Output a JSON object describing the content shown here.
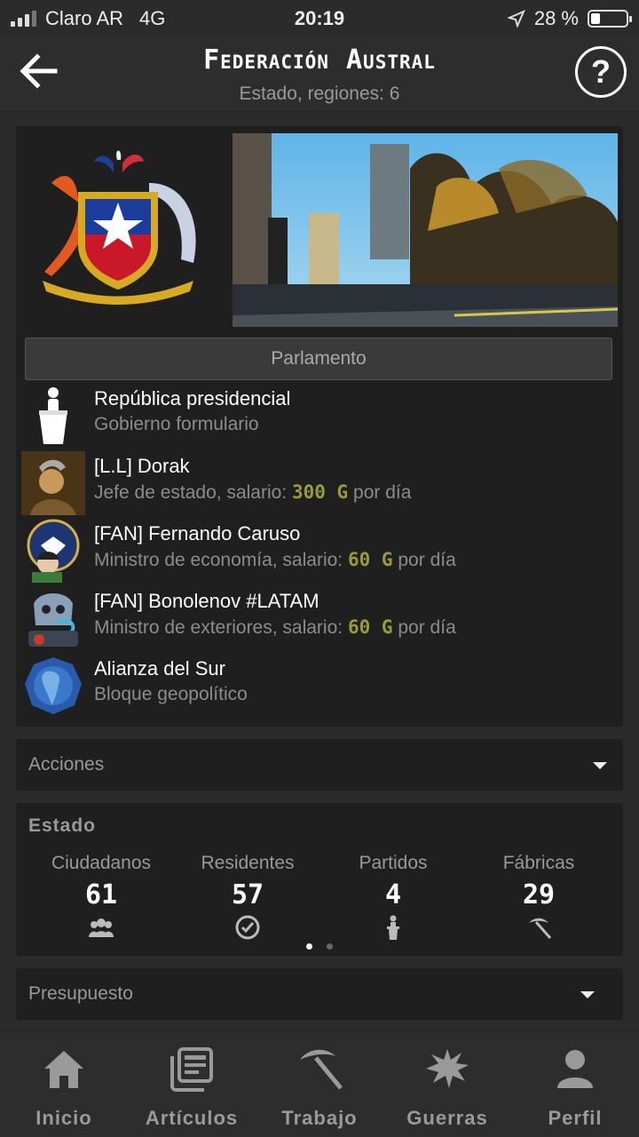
{
  "status_bar": {
    "carrier": "Claro AR",
    "network": "4G",
    "time": "20:19",
    "battery": "28 %"
  },
  "header": {
    "title": "Federación Austral",
    "subtitle": "Estado, regiones: 6"
  },
  "main": {
    "parliament_button": "Parlamento",
    "government": {
      "title": "República presidencial",
      "subtitle": "Gobierno formulario"
    },
    "officials": [
      {
        "name": "[L.L] Dorak",
        "role": "Jefe de estado, salario: ",
        "salary": "300 G",
        "suffix": " por día"
      },
      {
        "name": "[FAN] Fernando Caruso",
        "role": "Ministro de economía, salario: ",
        "salary": "60 G",
        "suffix": " por día"
      },
      {
        "name": "[FAN] Bonolenov #LATAM",
        "role": "Ministro de exteriores, salario: ",
        "salary": "60 G",
        "suffix": " por día"
      }
    ],
    "bloc": {
      "title": "Alianza del Sur",
      "subtitle": "Bloque geopolítico"
    }
  },
  "acciones": {
    "label": "Acciones"
  },
  "estado": {
    "heading": "Estado",
    "stats": [
      {
        "label": "Ciudadanos",
        "value": "61",
        "icon": "people-icon"
      },
      {
        "label": "Residentes",
        "value": "57",
        "icon": "check-circle-icon"
      },
      {
        "label": "Partidos",
        "value": "4",
        "icon": "person-podium-icon"
      },
      {
        "label": "Fábricas",
        "value": "29",
        "icon": "pickaxe-icon"
      }
    ],
    "page_count": 2,
    "active_page": 1
  },
  "presupuesto": {
    "label": "Presupuesto"
  },
  "bottom_nav": [
    {
      "label": "Inicio",
      "icon": "home-icon"
    },
    {
      "label": "Artículos",
      "icon": "articles-icon"
    },
    {
      "label": "Trabajo",
      "icon": "pickaxe-icon"
    },
    {
      "label": "Guerras",
      "icon": "explosion-icon"
    },
    {
      "label": "Perfil",
      "icon": "profile-icon"
    }
  ]
}
